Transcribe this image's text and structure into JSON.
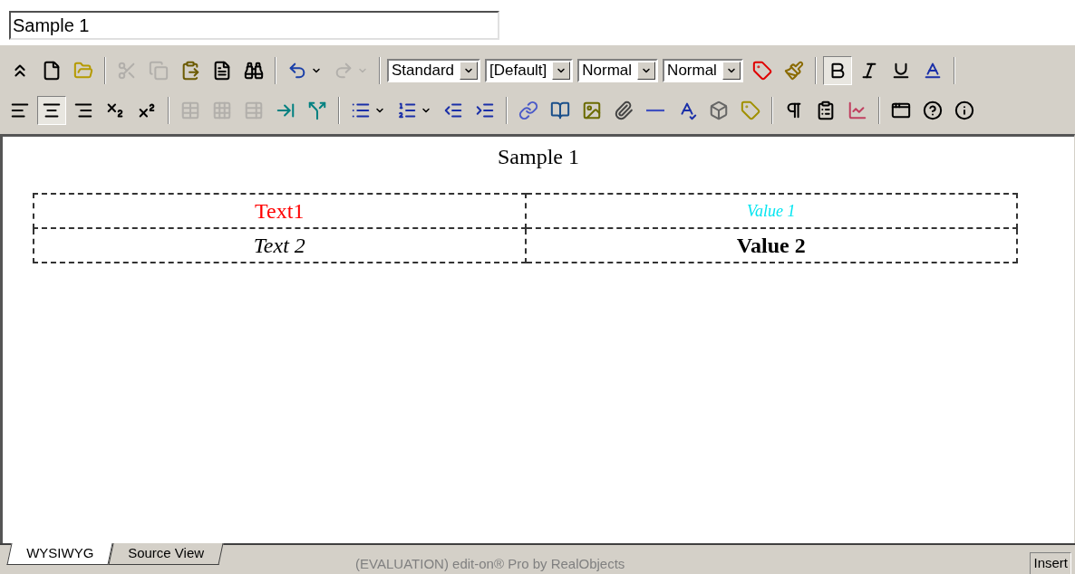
{
  "title_field": {
    "value": "Sample 1"
  },
  "toolbar_rows": [
    [
      {
        "kind": "button",
        "disabled": false,
        "selected": false
      },
      {
        "kind": "button",
        "disabled": false,
        "selected": false
      },
      {
        "kind": "button",
        "disabled": false,
        "selected": false
      },
      {
        "kind": "separator"
      },
      {
        "kind": "button",
        "disabled": true,
        "selected": false
      },
      {
        "kind": "button",
        "disabled": true,
        "selected": false
      },
      {
        "kind": "button",
        "disabled": false,
        "selected": false
      },
      {
        "kind": "button",
        "disabled": false,
        "selected": false
      },
      {
        "kind": "button",
        "disabled": false,
        "selected": false
      },
      {
        "kind": "separator"
      },
      {
        "kind": "split",
        "disabled": false,
        "selected": false
      },
      {
        "kind": "split",
        "disabled": true,
        "selected": false
      },
      {
        "kind": "separator"
      },
      {
        "kind": "select",
        "value": "Standard"
      },
      {
        "kind": "select",
        "value": "[Default]"
      },
      {
        "kind": "select",
        "value": "Normal"
      },
      {
        "kind": "select",
        "value": "Normal"
      },
      {
        "kind": "button",
        "disabled": false,
        "selected": false
      },
      {
        "kind": "button",
        "disabled": false,
        "selected": false
      },
      {
        "kind": "separator"
      },
      {
        "kind": "button",
        "disabled": false,
        "selected": true
      },
      {
        "kind": "button",
        "disabled": false,
        "selected": false
      },
      {
        "kind": "button",
        "disabled": false,
        "selected": false
      },
      {
        "kind": "button",
        "disabled": false,
        "selected": false
      },
      {
        "kind": "separator"
      }
    ],
    [
      {
        "kind": "button",
        "disabled": false,
        "selected": false
      },
      {
        "kind": "button",
        "disabled": false,
        "selected": true
      },
      {
        "kind": "button",
        "disabled": false,
        "selected": false
      },
      {
        "kind": "button",
        "disabled": false,
        "selected": false
      },
      {
        "kind": "button",
        "disabled": false,
        "selected": false
      },
      {
        "kind": "separator"
      },
      {
        "kind": "button",
        "disabled": true,
        "selected": false
      },
      {
        "kind": "button",
        "disabled": true,
        "selected": false
      },
      {
        "kind": "button",
        "disabled": true,
        "selected": false
      },
      {
        "kind": "button",
        "disabled": false,
        "selected": false
      },
      {
        "kind": "button",
        "disabled": false,
        "selected": false
      },
      {
        "kind": "separator"
      },
      {
        "kind": "split",
        "disabled": false,
        "selected": false
      },
      {
        "kind": "split",
        "disabled": false,
        "selected": false
      },
      {
        "kind": "button",
        "disabled": false,
        "selected": false
      },
      {
        "kind": "button",
        "disabled": false,
        "selected": false
      },
      {
        "kind": "separator"
      },
      {
        "kind": "button",
        "disabled": false,
        "selected": false
      },
      {
        "kind": "button",
        "disabled": false,
        "selected": false
      },
      {
        "kind": "button",
        "disabled": false,
        "selected": false
      },
      {
        "kind": "button",
        "disabled": false,
        "selected": false
      },
      {
        "kind": "button",
        "disabled": false,
        "selected": false
      },
      {
        "kind": "button",
        "disabled": false,
        "selected": false
      },
      {
        "kind": "button",
        "disabled": false,
        "selected": false
      },
      {
        "kind": "button",
        "disabled": false,
        "selected": false
      },
      {
        "kind": "separator"
      },
      {
        "kind": "button",
        "disabled": false,
        "selected": false
      },
      {
        "kind": "button",
        "disabled": false,
        "selected": false
      },
      {
        "kind": "button",
        "disabled": false,
        "selected": false
      },
      {
        "kind": "separator"
      },
      {
        "kind": "button",
        "disabled": false,
        "selected": false
      },
      {
        "kind": "button",
        "disabled": false,
        "selected": false
      },
      {
        "kind": "button",
        "disabled": false,
        "selected": false
      }
    ]
  ],
  "document": {
    "heading": "Sample 1",
    "table_rows": [
      [
        {
          "text": "Text1",
          "color": "#ff0000",
          "kind": "plain"
        },
        {
          "text": "Value 1",
          "color": "#00e5f0",
          "kind": "small-italic"
        }
      ],
      [
        {
          "text": "Text 2",
          "color": "#000000",
          "kind": "italic"
        },
        {
          "text": "Value 2",
          "color": "#000000",
          "kind": "bold"
        }
      ]
    ]
  },
  "view_tabs": [
    {
      "label": "WYSIWYG",
      "selected": true
    },
    {
      "label": "Source View",
      "selected": false
    }
  ],
  "status_bar": {
    "notice": "(EVALUATION) edit-on® Pro by RealObjects",
    "mode": "Insert"
  }
}
